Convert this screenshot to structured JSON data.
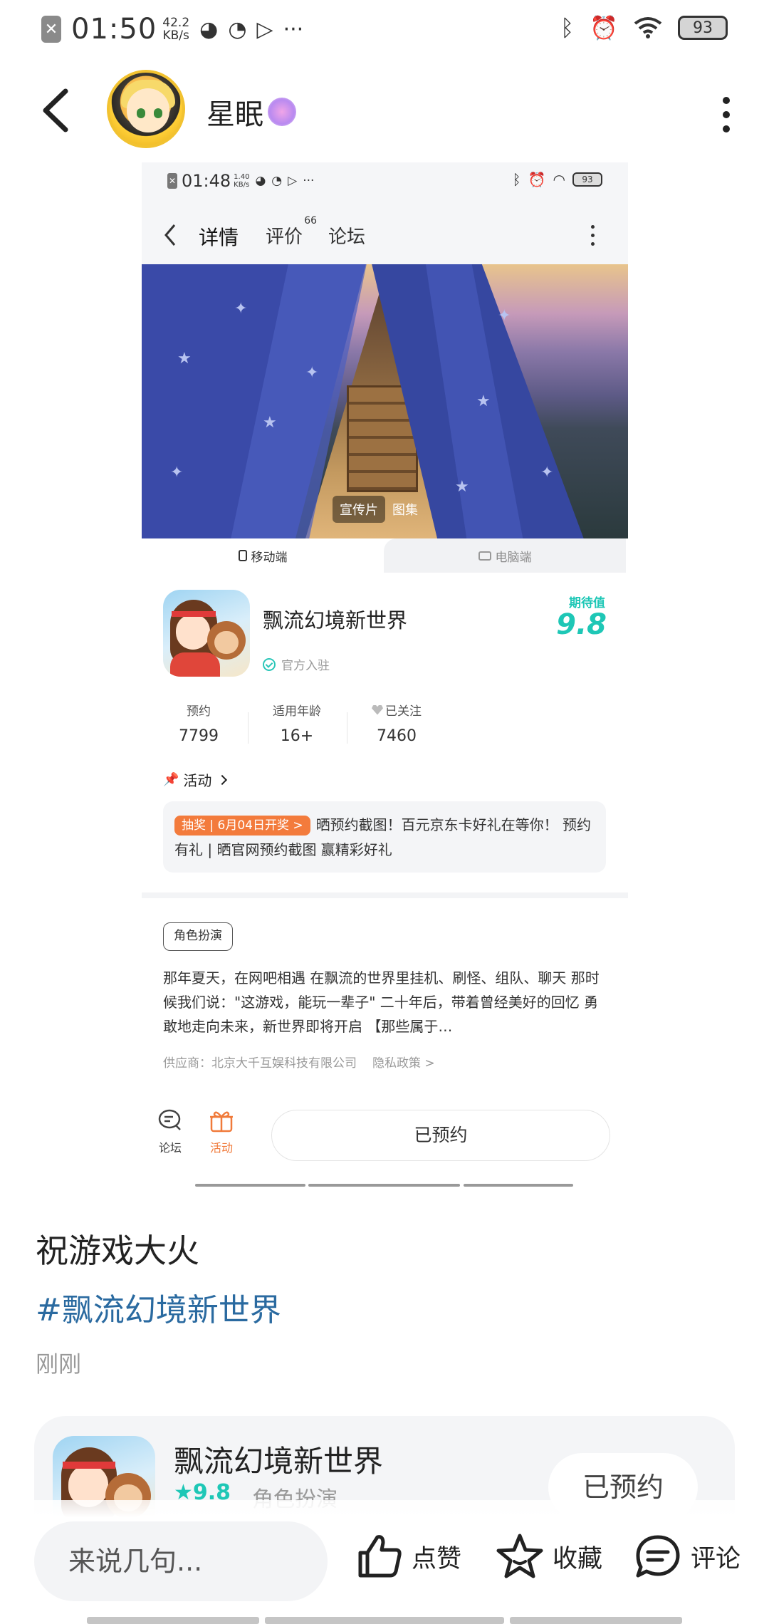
{
  "status_bar": {
    "time": "01:50",
    "net_speed_value": "42.2",
    "net_speed_unit": "KB/s",
    "more": "···",
    "battery": "93"
  },
  "post_header": {
    "username": "星眠"
  },
  "screenshot": {
    "status_bar": {
      "time": "01:48",
      "net_speed_value": "1.40",
      "net_speed_unit": "KB/s",
      "more": "···",
      "battery": "93"
    },
    "tabs": [
      {
        "label": "详情",
        "active": true
      },
      {
        "label": "评价",
        "count": "66"
      },
      {
        "label": "论坛"
      }
    ],
    "banner_tabs": [
      "宣传片",
      "图集"
    ],
    "platforms": [
      "移动端",
      "电脑端"
    ],
    "game": {
      "title": "飘流幻境新世界",
      "official": "官方入驻",
      "rating_label": "期待值",
      "rating": "9.8"
    },
    "stats": [
      {
        "label": "预约",
        "value": "7799"
      },
      {
        "label": "适用年龄",
        "value": "16+"
      },
      {
        "label": "已关注",
        "value": "7460"
      }
    ],
    "activity": {
      "header": "活动",
      "tag": "抽奖 | 6月04日开奖 >",
      "text": "晒预约截图！百元京东卡好礼在等你！ 预约有礼 | 晒官网预约截图 赢精彩好礼"
    },
    "genre_tag": "角色扮演",
    "description": "那年夏天，在网吧相遇 在飘流的世界里挂机、刷怪、组队、聊天 那时候我们说：\"这游戏，能玩一辈子\" 二十年后，带着曾经美好的回忆 勇敢地走向未来，新世界即将开启 【那些属于…",
    "supplier": "供应商：北京大千互娱科技有限公司",
    "privacy": "隐私政策 >",
    "bottom": {
      "forum": "论坛",
      "activity": "活动",
      "reserved": "已预约"
    }
  },
  "post": {
    "text": "祝游戏大火",
    "hashtag": "#飘流幻境新世界",
    "time": "刚刚"
  },
  "game_card": {
    "title": "飘流幻境新世界",
    "rating": "9.8",
    "genre": "角色扮演",
    "button": "已预约"
  },
  "action_bar": {
    "comment_placeholder": "来说几句...",
    "like": "点赞",
    "favorite": "收藏",
    "comment": "评论"
  },
  "colors": {
    "accent_teal": "#1ec7b6",
    "hashtag_blue": "#2a6aa0",
    "activity_orange": "#f37b3c"
  }
}
